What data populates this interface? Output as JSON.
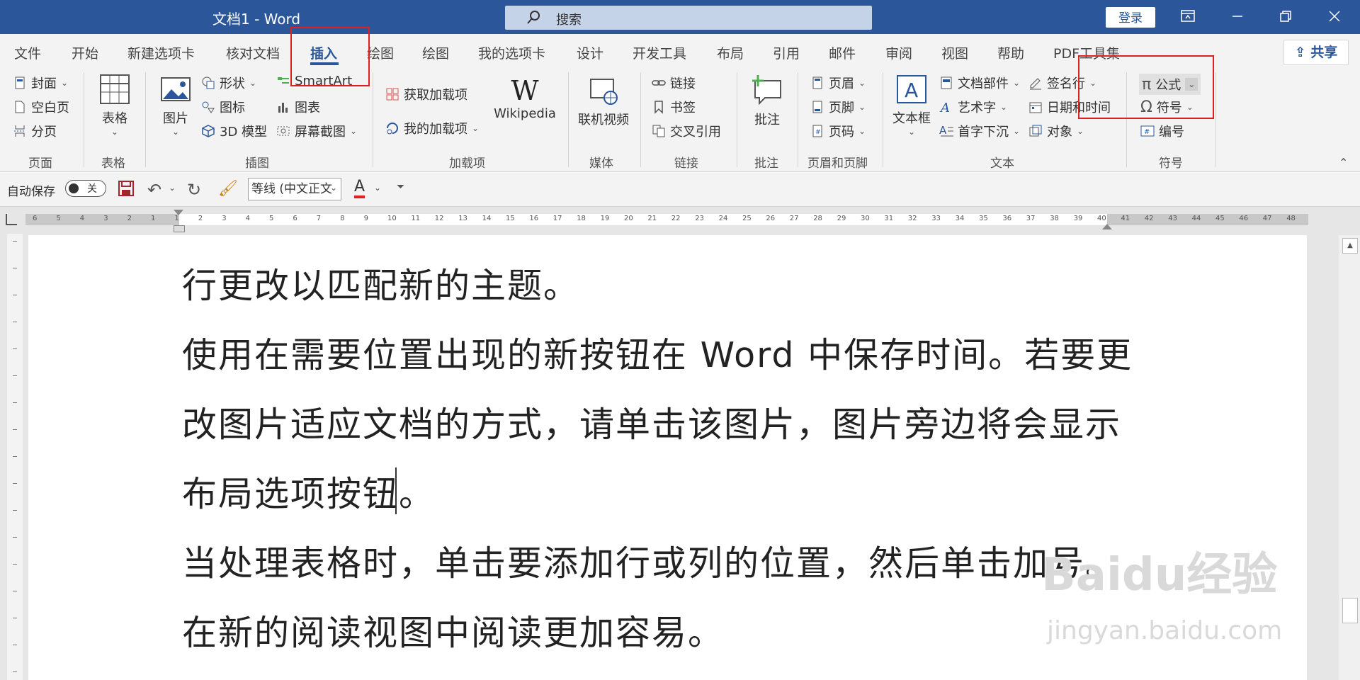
{
  "window": {
    "title": "文档1  -  Word",
    "search_text": "搜索",
    "login_label": "登录"
  },
  "tabs": [
    {
      "label": "文件"
    },
    {
      "label": "开始"
    },
    {
      "label": "新建选项卡"
    },
    {
      "label": "核对文档"
    },
    {
      "label": "插入",
      "active": true
    },
    {
      "label": "绘图"
    },
    {
      "label": "绘图"
    },
    {
      "label": "我的选项卡"
    },
    {
      "label": "设计"
    },
    {
      "label": "开发工具"
    },
    {
      "label": "布局"
    },
    {
      "label": "引用"
    },
    {
      "label": "邮件"
    },
    {
      "label": "审阅"
    },
    {
      "label": "视图"
    },
    {
      "label": "帮助"
    },
    {
      "label": "PDF工具集"
    }
  ],
  "share_label": "共享",
  "ribbon": {
    "pages": {
      "cover": "封面",
      "blank": "空白页",
      "break": "分页",
      "group": "页面"
    },
    "tables": {
      "table": "表格",
      "group": "表格"
    },
    "illustrations": {
      "picture": "图片",
      "shapes": "形状",
      "icons": "图标",
      "model3d": "3D 模型",
      "smartart": "SmartArt",
      "chart": "图表",
      "screenshot": "屏幕截图",
      "group": "插图"
    },
    "addins": {
      "get": "获取加载项",
      "mine": "我的加载项",
      "wikipedia": "Wikipedia",
      "group": "加载项"
    },
    "media": {
      "video": "联机视频",
      "group": "媒体"
    },
    "links": {
      "link": "链接",
      "bookmark": "书签",
      "crossref": "交叉引用",
      "group": "链接"
    },
    "comments": {
      "comment": "批注",
      "group": "批注"
    },
    "header_footer": {
      "header": "页眉",
      "footer": "页脚",
      "page_number": "页码",
      "group": "页眉和页脚"
    },
    "text": {
      "textbox": "文本框",
      "quickparts": "文档部件",
      "wordart": "艺术字",
      "dropcap": "首字下沉",
      "signature": "签名行",
      "datetime": "日期和时间",
      "object": "对象",
      "group": "文本"
    },
    "symbols": {
      "equation": "公式",
      "symbol": "符号",
      "number": "编号",
      "group": "符号"
    }
  },
  "qat": {
    "autosave_label": "自动保存",
    "autosave_state": "关",
    "font_value": "等线 (中文正文",
    "font_color_letter": "A"
  },
  "ruler_ticks": [
    "6",
    "5",
    "4",
    "3",
    "2",
    "1",
    "1",
    "2",
    "3",
    "4",
    "5",
    "6",
    "7",
    "8",
    "9",
    "10",
    "11",
    "12",
    "13",
    "14",
    "15",
    "16",
    "17",
    "18",
    "19",
    "20",
    "21",
    "22",
    "23",
    "24",
    "25",
    "26",
    "27",
    "28",
    "29",
    "30",
    "31",
    "32",
    "33",
    "34",
    "35",
    "36",
    "37",
    "38",
    "39",
    "40",
    "41",
    "42",
    "43",
    "44",
    "45",
    "46",
    "47",
    "48"
  ],
  "document": {
    "lines": [
      "行更改以匹配新的主题。",
      "使用在需要位置出现的新按钮在  Word  中保存时间。若要更",
      "改图片适应文档的方式，请单击该图片，图片旁边将会显示",
      "布局选项按钮。",
      "当处理表格时，单击要添加行或列的位置，然后单击加号。",
      "在新的阅读视图中阅读更加容易。"
    ]
  },
  "watermark": {
    "logo": "Baidu经验",
    "url": "jingyan.baidu.com"
  },
  "colors": {
    "accent": "#2b579a",
    "highlight": "#e02020"
  }
}
